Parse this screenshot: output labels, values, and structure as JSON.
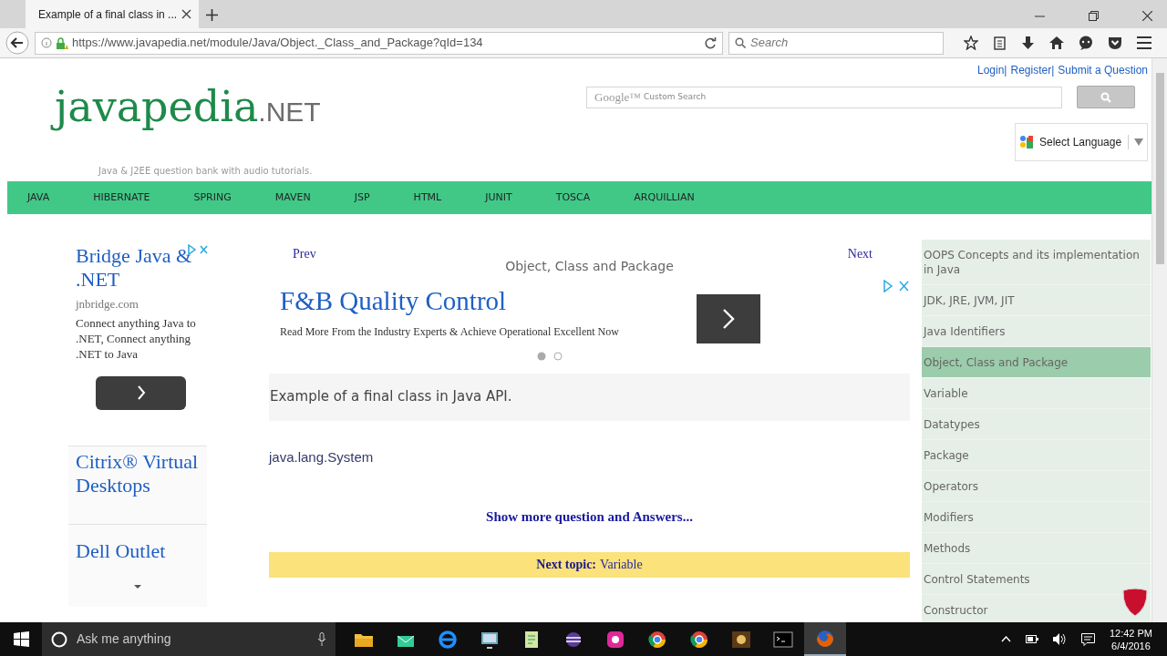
{
  "browser": {
    "tab_title": "Example of a final class in ...",
    "url": "https://www.javapedia.net/module/Java/Object._Class_and_Package?qId=134",
    "search_placeholder": "Search"
  },
  "header": {
    "links": [
      "Login|",
      "Register|",
      "Submit a Question"
    ],
    "logo": {
      "main": "javapedia",
      "suffix": ".NET"
    },
    "tagline": "Java & J2EE question bank with audio tutorials.",
    "search": {
      "brand": "Google™",
      "placeholder": "Custom Search"
    },
    "language": "Select Language"
  },
  "nav": [
    "JAVA",
    "HIBERNATE",
    "SPRING",
    "MAVEN",
    "JSP",
    "HTML",
    "JUNIT",
    "TOSCA",
    "ARQUILLIAN"
  ],
  "left_ads": {
    "title": "Bridge Java & .NET",
    "domain": "jnbridge.com",
    "body": "Connect anything Java to .NET, Connect anything .NET to Java",
    "links": [
      "Citrix® Virtual Desktops",
      "Dell Outlet"
    ]
  },
  "main": {
    "prev": "Prev",
    "next": "Next",
    "title": "Object, Class and Package",
    "ad": {
      "title": "F&B Quality Control",
      "text": "Read More From the Industry Experts & Achieve Operational Excellent Now",
      "dots": [
        {
          "selected": true
        },
        {
          "selected": false
        }
      ]
    },
    "question": "Example of a final class in Java API.",
    "answer": "java.lang.System",
    "more": "Show more question and Answers...",
    "next_topic": {
      "label": "Next topic:",
      "value": "Variable"
    }
  },
  "sidebar": [
    {
      "label": "OOPS Concepts and its implementation in Java",
      "selected": false
    },
    {
      "label": "JDK, JRE, JVM, JIT",
      "selected": false
    },
    {
      "label": "Java Identifiers",
      "selected": false
    },
    {
      "label": "Object, Class and Package",
      "selected": true
    },
    {
      "label": "Variable",
      "selected": false
    },
    {
      "label": "Datatypes",
      "selected": false
    },
    {
      "label": "Package",
      "selected": false
    },
    {
      "label": "Operators",
      "selected": false
    },
    {
      "label": "Modifiers",
      "selected": false
    },
    {
      "label": "Methods",
      "selected": false
    },
    {
      "label": "Control Statements",
      "selected": false
    },
    {
      "label": "Constructor",
      "selected": false
    }
  ],
  "taskbar": {
    "search_placeholder": "Ask me anything",
    "time": "12:42 PM",
    "date": "6/4/2016"
  }
}
